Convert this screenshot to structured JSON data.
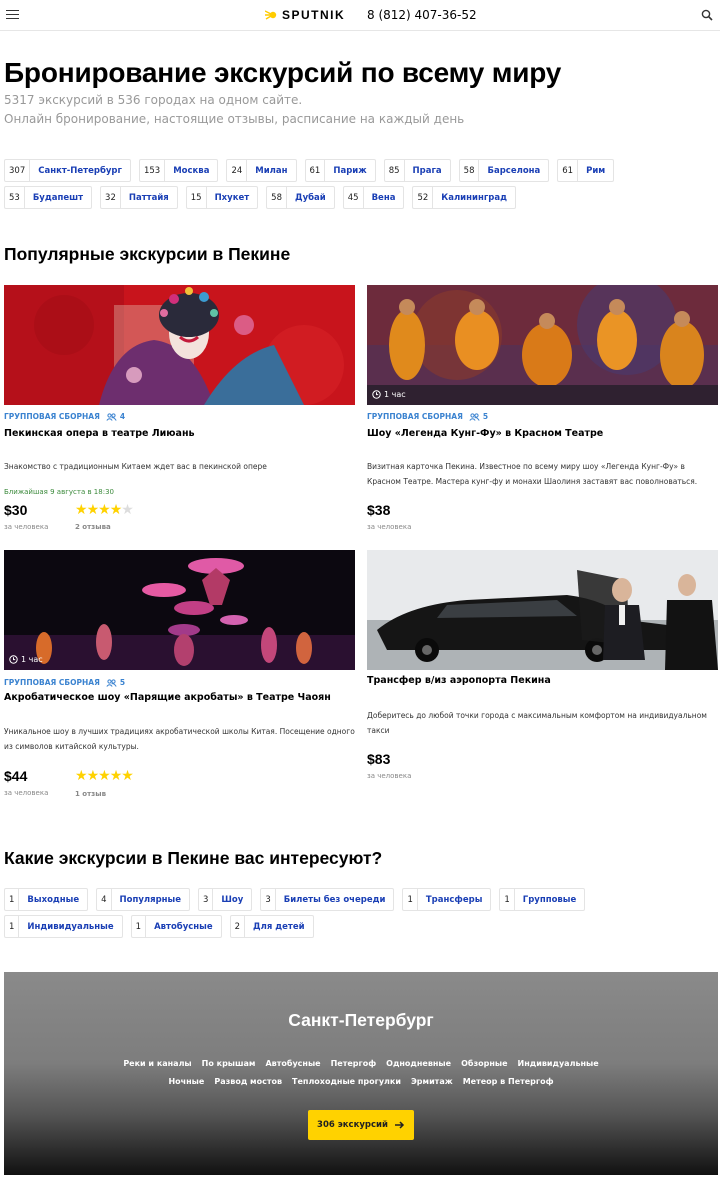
{
  "header": {
    "logo_text": "SPUTNIK",
    "phone": "8 (812) 407-36-52",
    "icons": [
      "menu-icon",
      "search-icon"
    ]
  },
  "hero": {
    "title": "Бронирование экскурсий по всему миру",
    "stats": "5317 экскурсий в 536 городах на одном сайте.",
    "tagline": "Онлайн бронирование, настоящие отзывы, расписание на каждый день"
  },
  "cities": [
    {
      "count": "307",
      "name": "Санкт-Петербург"
    },
    {
      "count": "153",
      "name": "Москва"
    },
    {
      "count": "24",
      "name": "Милан"
    },
    {
      "count": "61",
      "name": "Париж"
    },
    {
      "count": "85",
      "name": "Прага"
    },
    {
      "count": "58",
      "name": "Барселона"
    },
    {
      "count": "61",
      "name": "Рим"
    },
    {
      "count": "53",
      "name": "Будапешт"
    },
    {
      "count": "32",
      "name": "Паттайя"
    },
    {
      "count": "15",
      "name": "Пхукет"
    },
    {
      "count": "58",
      "name": "Дубай"
    },
    {
      "count": "45",
      "name": "Вена"
    },
    {
      "count": "52",
      "name": "Калининград"
    }
  ],
  "popular": {
    "title": "Популярные экскурсии в Пекине",
    "cards": [
      {
        "type": "ГРУППОВАЯ СБОРНАЯ",
        "group_size": "4",
        "title": "Пекинская опера в театре Лиюань",
        "description": "Знакомство с традиционным Китаем ждет вас в пекинской опере",
        "nearest": "Ближайшая 9 августа в 18:30",
        "price": "$30",
        "per": "за человека",
        "rating": 4,
        "reviews": "2 отзыва",
        "duration": ""
      },
      {
        "type": "ГРУППОВАЯ СБОРНАЯ",
        "group_size": "5",
        "title": "Шоу «Легенда Кунг-Фу» в Красном Театре",
        "description": "Визитная карточка Пекина. Известное по всему миру шоу «Легенда Кунг-Фу» в Красном Театре. Мастера кунг-фу и монахи Шаолиня заставят вас поволноваться.",
        "price": "$38",
        "per": "за человека",
        "duration": "1 час"
      },
      {
        "type": "ГРУППОВАЯ СБОРНАЯ",
        "group_size": "5",
        "title": "Акробатическое шоу «Парящие акробаты» в Театре Чаоян",
        "description": "Уникальное шоу в лучших традициях акробатической школы Китая. Посещение одного из символов китайской культуры.",
        "price": "$44",
        "per": "за человека",
        "rating": 5,
        "reviews": "1 отзыв",
        "duration": "1 час"
      },
      {
        "title": "Трансфер в/из аэропорта Пекина",
        "description": "Доберитесь до любой точки города с максимальным комфортом на индивидуальном такси",
        "price": "$83",
        "per": "за человека"
      }
    ]
  },
  "interests": {
    "title": "Какие экскурсии в Пекине вас интересуют?",
    "tags": [
      {
        "count": "1",
        "name": "Выходные"
      },
      {
        "count": "4",
        "name": "Популярные"
      },
      {
        "count": "3",
        "name": "Шоу"
      },
      {
        "count": "3",
        "name": "Билеты без очереди"
      },
      {
        "count": "1",
        "name": "Трансферы"
      },
      {
        "count": "1",
        "name": "Групповые"
      },
      {
        "count": "1",
        "name": "Индивидуальные"
      },
      {
        "count": "1",
        "name": "Автобусные"
      },
      {
        "count": "2",
        "name": "Для детей"
      }
    ]
  },
  "banner": {
    "city": "Санкт-Петербург",
    "links_row1": [
      "Реки и каналы",
      "По крышам",
      "Автобусные",
      "Петергоф",
      "Однодневные",
      "Обзорные",
      "Индивидуальные"
    ],
    "links_row2": [
      "Ночные",
      "Развод мостов",
      "Теплоходные прогулки",
      "Эрмитаж",
      "Метеор в Петергоф"
    ],
    "button": "306 экскурсий"
  },
  "colors": {
    "link_blue": "#1a3fb5",
    "type_blue": "#3b83d0",
    "star_yellow": "#ffd200",
    "button_yellow": "#ffd200"
  }
}
